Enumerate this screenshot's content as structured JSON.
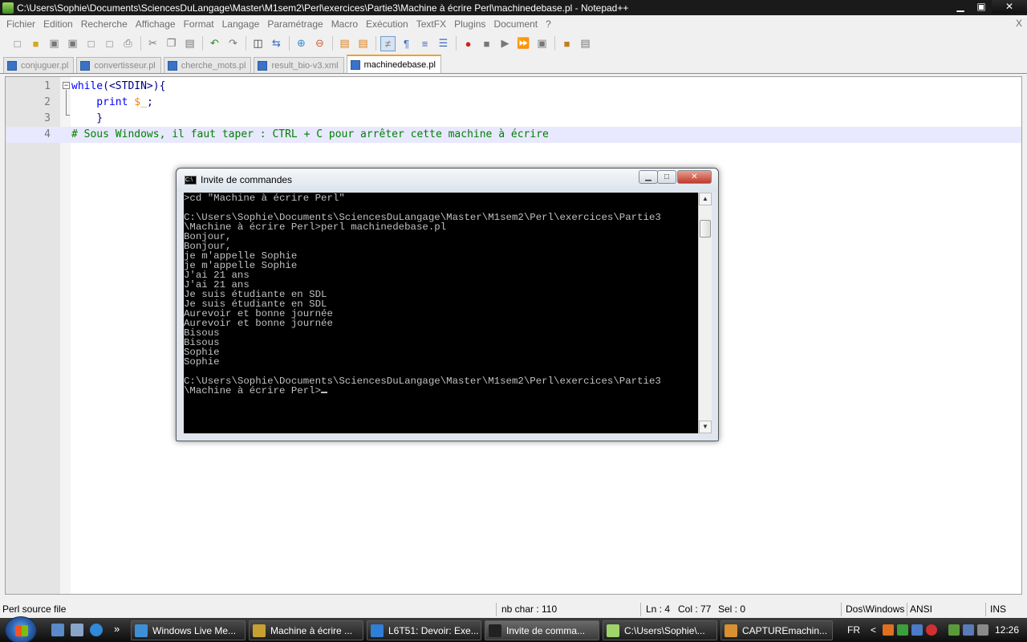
{
  "window": {
    "title": "C:\\Users\\Sophie\\Documents\\SciencesDuLangage\\Master\\M1sem2\\Perl\\exercices\\Partie3\\Machine à écrire Perl\\machinedebase.pl - Notepad++",
    "minimize": "▁",
    "maximize": "▣",
    "close": "✕"
  },
  "menu": {
    "items": [
      "Fichier",
      "Edition",
      "Recherche",
      "Affichage",
      "Format",
      "Langage",
      "Paramétrage",
      "Macro",
      "Exécution",
      "TextFX",
      "Plugins",
      "Document",
      "?"
    ],
    "close": "X"
  },
  "toolbar": {
    "icons": [
      "new-file-icon",
      "open-file-icon",
      "save-icon",
      "save-all-icon",
      "close-icon",
      "close-all-icon",
      "print-icon",
      "cut-icon",
      "copy-icon",
      "paste-icon",
      "undo-icon",
      "redo-icon",
      "find-icon",
      "replace-icon",
      "zoom-in-icon",
      "zoom-out-icon",
      "sync-vertical-icon",
      "sync-horizontal-icon",
      "wrap-icon",
      "show-all-chars-icon",
      "indent-guide-icon",
      "fold-icon",
      "record-macro-icon",
      "stop-macro-icon",
      "play-macro-icon",
      "run-macro-multiple-icon",
      "save-macro-icon",
      "trim-icon",
      "launch-icon"
    ]
  },
  "tabs": [
    {
      "label": "conjuguer.pl",
      "active": false
    },
    {
      "label": "convertisseur.pl",
      "active": false
    },
    {
      "label": "cherche_mots.pl",
      "active": false
    },
    {
      "label": "result_bio-v3.xml",
      "active": false
    },
    {
      "label": "machinedebase.pl",
      "active": true
    }
  ],
  "editor": {
    "lines": [
      {
        "num": "1",
        "parts": [
          {
            "t": "while",
            "c": "kw"
          },
          {
            "t": "(<STDIN>){",
            "c": "op"
          }
        ]
      },
      {
        "num": "2",
        "parts": [
          {
            "t": "    print ",
            "c": "kw"
          },
          {
            "t": "$_",
            "c": "var"
          },
          {
            "t": ";",
            "c": "op"
          }
        ]
      },
      {
        "num": "3",
        "parts": [
          {
            "t": "    }",
            "c": "op"
          }
        ]
      },
      {
        "num": "4",
        "parts": [
          {
            "t": "# Sous Windows, il faut taper : CTRL + C pour arrêter cette machine à écrire",
            "c": "comment"
          }
        ]
      }
    ]
  },
  "cmd": {
    "title": "Invite de commandes",
    "icon_label": "C:\\",
    "buttons": {
      "minimize": "▁",
      "maximize": "□",
      "close": "✕"
    },
    "lines": [
      ">cd \"Machine à écrire Perl\"",
      "",
      "C:\\Users\\Sophie\\Documents\\SciencesDuLangage\\Master\\M1sem2\\Perl\\exercices\\Partie3",
      "\\Machine à écrire Perl>perl machinedebase.pl",
      "Bonjour,",
      "Bonjour,",
      "je m'appelle Sophie",
      "je m'appelle Sophie",
      "J'ai 21 ans",
      "J'ai 21 ans",
      "Je suis étudiante en SDL",
      "Je suis étudiante en SDL",
      "Aurevoir et bonne journée",
      "Aurevoir et bonne journée",
      "Bisous",
      "Bisous",
      "Sophie",
      "Sophie",
      "",
      "C:\\Users\\Sophie\\Documents\\SciencesDuLangage\\Master\\M1sem2\\Perl\\exercices\\Partie3",
      "\\Machine à écrire Perl>"
    ],
    "scroll_up": "▲",
    "scroll_down": "▼"
  },
  "statusbar": {
    "file_type": "Perl source file",
    "nb_char": "nb char : 110",
    "ln": "Ln : 4",
    "col": "Col : 77",
    "sel": "Sel : 0",
    "eol": "Dos\\Windows",
    "encoding": "ANSI",
    "mode": "INS"
  },
  "taskbar": {
    "chevron": "»",
    "tasks": [
      {
        "label": "Windows Live Me...",
        "icon_color": "#3d8fd6",
        "active": false
      },
      {
        "label": "Machine à écrire ...",
        "icon_color": "#c8a030",
        "active": false
      },
      {
        "label": "L6T51: Devoir: Exe...",
        "icon_color": "#2f7fd6",
        "active": false
      },
      {
        "label": "Invite de comma...",
        "icon_color": "#222222",
        "active": true
      },
      {
        "label": "C:\\Users\\Sophie\\...",
        "icon_color": "#9fd46a",
        "active": false
      },
      {
        "label": "CAPTUREmachin...",
        "icon_color": "#d89030",
        "active": false
      }
    ],
    "lang": "FR",
    "tray_chevron": "<",
    "clock": "12:26"
  },
  "colors": {
    "keyword": "#0000ff",
    "variable": "#ff8000",
    "comment": "#008000",
    "current_line": "#e8e8ff"
  }
}
